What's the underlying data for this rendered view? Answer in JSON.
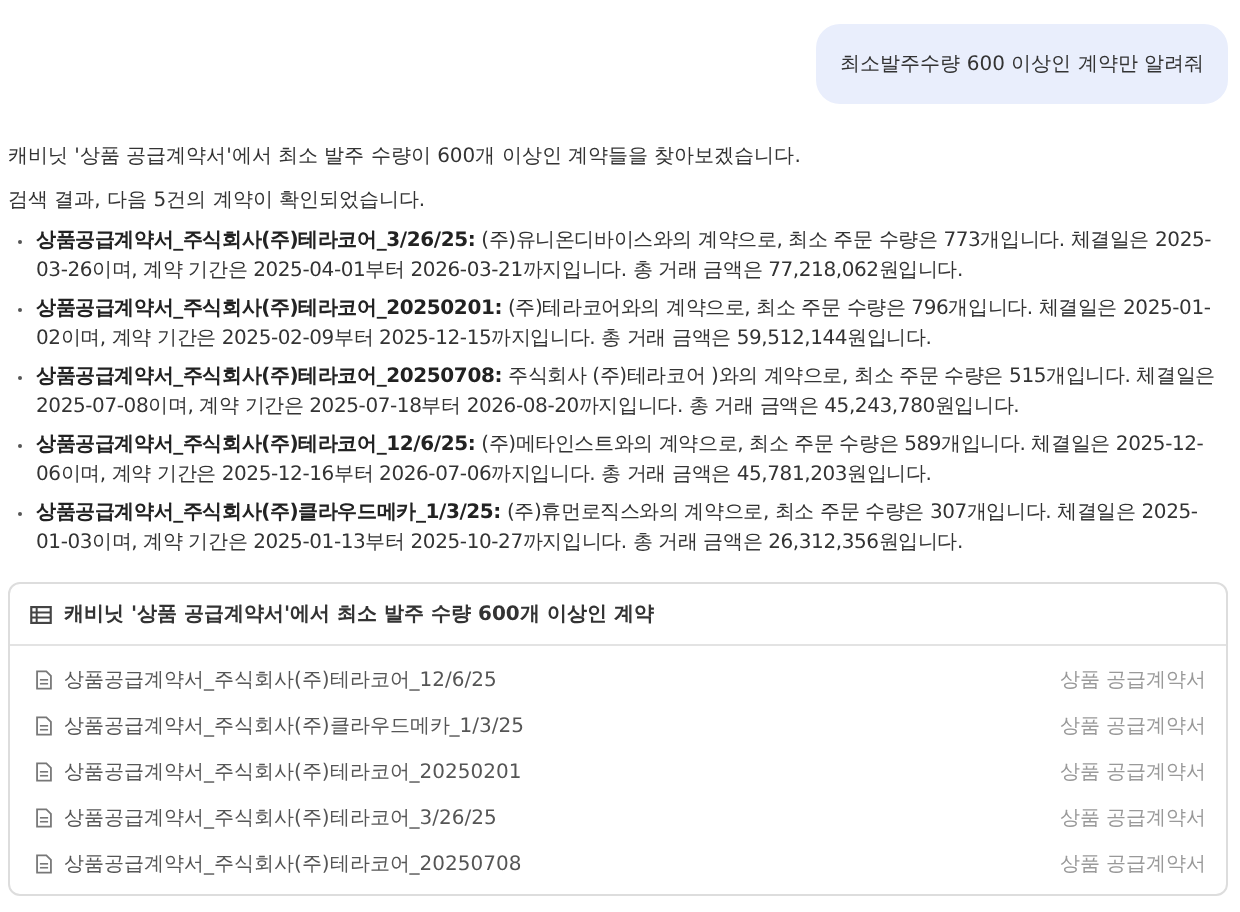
{
  "user_message": "최소발주수량 600 이상인 계약만 알려줘",
  "answer": {
    "intro": "캐비닛 '상품 공급계약서'에서 최소 발주 수량이 600개 이상인 계약들을 찾아보겠습니다.",
    "summary": "검색 결과, 다음 5건의 계약이 확인되었습니다.",
    "results": [
      {
        "title": "상품공급계약서_주식회사(주)테라코어_3/26/25:",
        "text": " (주)유니온디바이스와의 계약으로, 최소 주문 수량은 773개입니다. 체결일은 2025-03-26이며, 계약 기간은 2025-04-01부터 2026-03-21까지입니다. 총 거래 금액은 77,218,062원입니다."
      },
      {
        "title": "상품공급계약서_주식회사(주)테라코어_20250201:",
        "text": " (주)테라코어와의 계약으로, 최소 주문 수량은 796개입니다. 체결일은 2025-01-02이며, 계약 기간은 2025-02-09부터 2025-12-15까지입니다. 총 거래 금액은 59,512,144원입니다."
      },
      {
        "title": "상품공급계약서_주식회사(주)테라코어_20250708:",
        "text": " 주식회사 (주)테라코어 )와의 계약으로, 최소 주문 수량은 515개입니다. 체결일은 2025-07-08이며, 계약 기간은 2025-07-18부터 2026-08-20까지입니다. 총 거래 금액은 45,243,780원입니다."
      },
      {
        "title": "상품공급계약서_주식회사(주)테라코어_12/6/25:",
        "text": " (주)메타인스트와의 계약으로, 최소 주문 수량은 589개입니다. 체결일은 2025-12-06이며, 계약 기간은 2025-12-16부터 2026-07-06까지입니다. 총 거래 금액은 45,781,203원입니다."
      },
      {
        "title": "상품공급계약서_주식회사(주)클라우드메카_1/3/25:",
        "text": " (주)휴먼로직스와의 계약으로, 최소 주문 수량은 307개입니다. 체결일은 2025-01-03이며, 계약 기간은 2025-01-13부터 2025-10-27까지입니다. 총 거래 금액은 26,312,356원입니다."
      }
    ]
  },
  "result_card": {
    "title": "캐비닛 '상품 공급계약서'에서 최소 발주 수량 600개 이상인 계약",
    "documents": [
      {
        "name": "상품공급계약서_주식회사(주)테라코어_12/6/25",
        "type": "상품 공급계약서"
      },
      {
        "name": "상품공급계약서_주식회사(주)클라우드메카_1/3/25",
        "type": "상품 공급계약서"
      },
      {
        "name": "상품공급계약서_주식회사(주)테라코어_20250201",
        "type": "상품 공급계약서"
      },
      {
        "name": "상품공급계약서_주식회사(주)테라코어_3/26/25",
        "type": "상품 공급계약서"
      },
      {
        "name": "상품공급계약서_주식회사(주)테라코어_20250708",
        "type": "상품 공급계약서"
      }
    ]
  }
}
